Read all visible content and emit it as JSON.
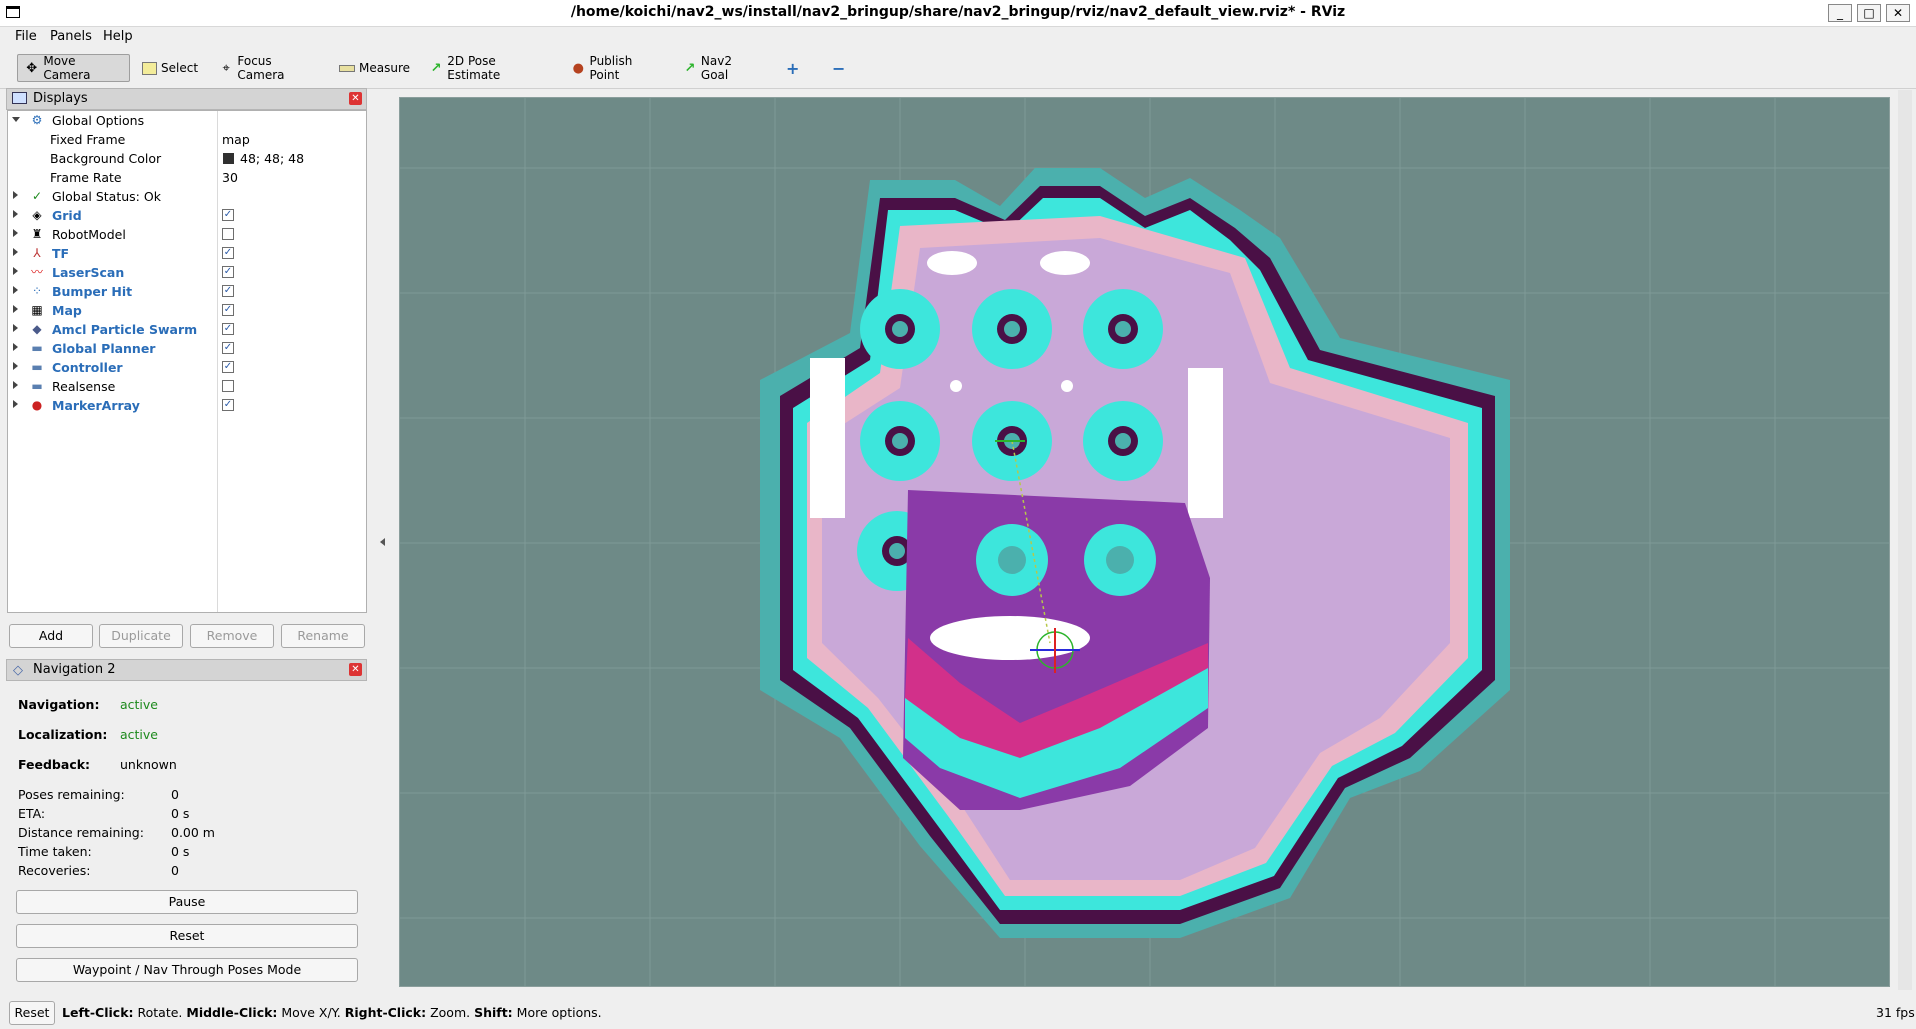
{
  "window": {
    "title": "/home/koichi/nav2_ws/install/nav2_bringup/share/nav2_bringup/rviz/nav2_default_view.rviz* - RViz",
    "minimize": "_",
    "maximize": "□",
    "close": "✕"
  },
  "menu": {
    "file": "File",
    "panels": "Panels",
    "help": "Help"
  },
  "toolbar": {
    "move_camera": "Move Camera",
    "select": "Select",
    "focus_camera": "Focus Camera",
    "measure": "Measure",
    "pose_estimate": "2D Pose Estimate",
    "publish_point": "Publish Point",
    "nav2_goal": "Nav2 Goal",
    "add_tool": "+",
    "remove_tool": "−"
  },
  "displays": {
    "title": "Displays",
    "rows": [
      {
        "label": "Global Options",
        "value": ""
      },
      {
        "label": "Fixed Frame",
        "value": "map"
      },
      {
        "label": "Background Color",
        "value": "48; 48; 48"
      },
      {
        "label": "Frame Rate",
        "value": "30"
      },
      {
        "label": "Global Status: Ok",
        "value": ""
      },
      {
        "label": "Grid",
        "checked": true
      },
      {
        "label": "RobotModel",
        "checked": false
      },
      {
        "label": "TF",
        "checked": true
      },
      {
        "label": "LaserScan",
        "checked": true
      },
      {
        "label": "Bumper Hit",
        "checked": true
      },
      {
        "label": "Map",
        "checked": true
      },
      {
        "label": "Amcl Particle Swarm",
        "checked": true
      },
      {
        "label": "Global Planner",
        "checked": true
      },
      {
        "label": "Controller",
        "checked": true
      },
      {
        "label": "Realsense",
        "checked": false
      },
      {
        "label": "MarkerArray",
        "checked": true
      }
    ],
    "background_swatch": "#303030",
    "buttons": {
      "add": "Add",
      "duplicate": "Duplicate",
      "remove": "Remove",
      "rename": "Rename"
    }
  },
  "navigation": {
    "title": "Navigation 2",
    "navigation_label": "Navigation:",
    "navigation_value": "active",
    "localization_label": "Localization:",
    "localization_value": "active",
    "feedback_label": "Feedback:",
    "feedback_value": "unknown",
    "poses_label": "Poses remaining:",
    "poses_value": "0",
    "eta_label": "ETA:",
    "eta_value": "0 s",
    "distance_label": "Distance remaining:",
    "distance_value": "0.00 m",
    "time_label": "Time taken:",
    "time_value": "0 s",
    "recoveries_label": "Recoveries:",
    "recoveries_value": "0",
    "pause": "Pause",
    "reset": "Reset",
    "waypoint": "Waypoint / Nav Through Poses Mode"
  },
  "status": {
    "reset": "Reset",
    "left_click": "Left-Click:",
    "left_click_desc": " Rotate. ",
    "middle_click": "Middle-Click:",
    "middle_click_desc": " Move X/Y. ",
    "right_click": "Right-Click:",
    "right_click_desc": " Zoom. ",
    "shift": "Shift:",
    "shift_desc": " More options.",
    "fps": "31 fps"
  },
  "colors": {
    "viewport_bg": "#6e8a87",
    "costmap_dark": "#4a1046",
    "costmap_cyan": "#3de6dc",
    "costmap_pink": "#e9b6c8",
    "costmap_violet": "#c9a8d8",
    "local_magenta": "#c0208a",
    "local_purple": "#8a3aa8",
    "active_green": "#1d8a1d",
    "display_blue": "#2a6db8"
  }
}
